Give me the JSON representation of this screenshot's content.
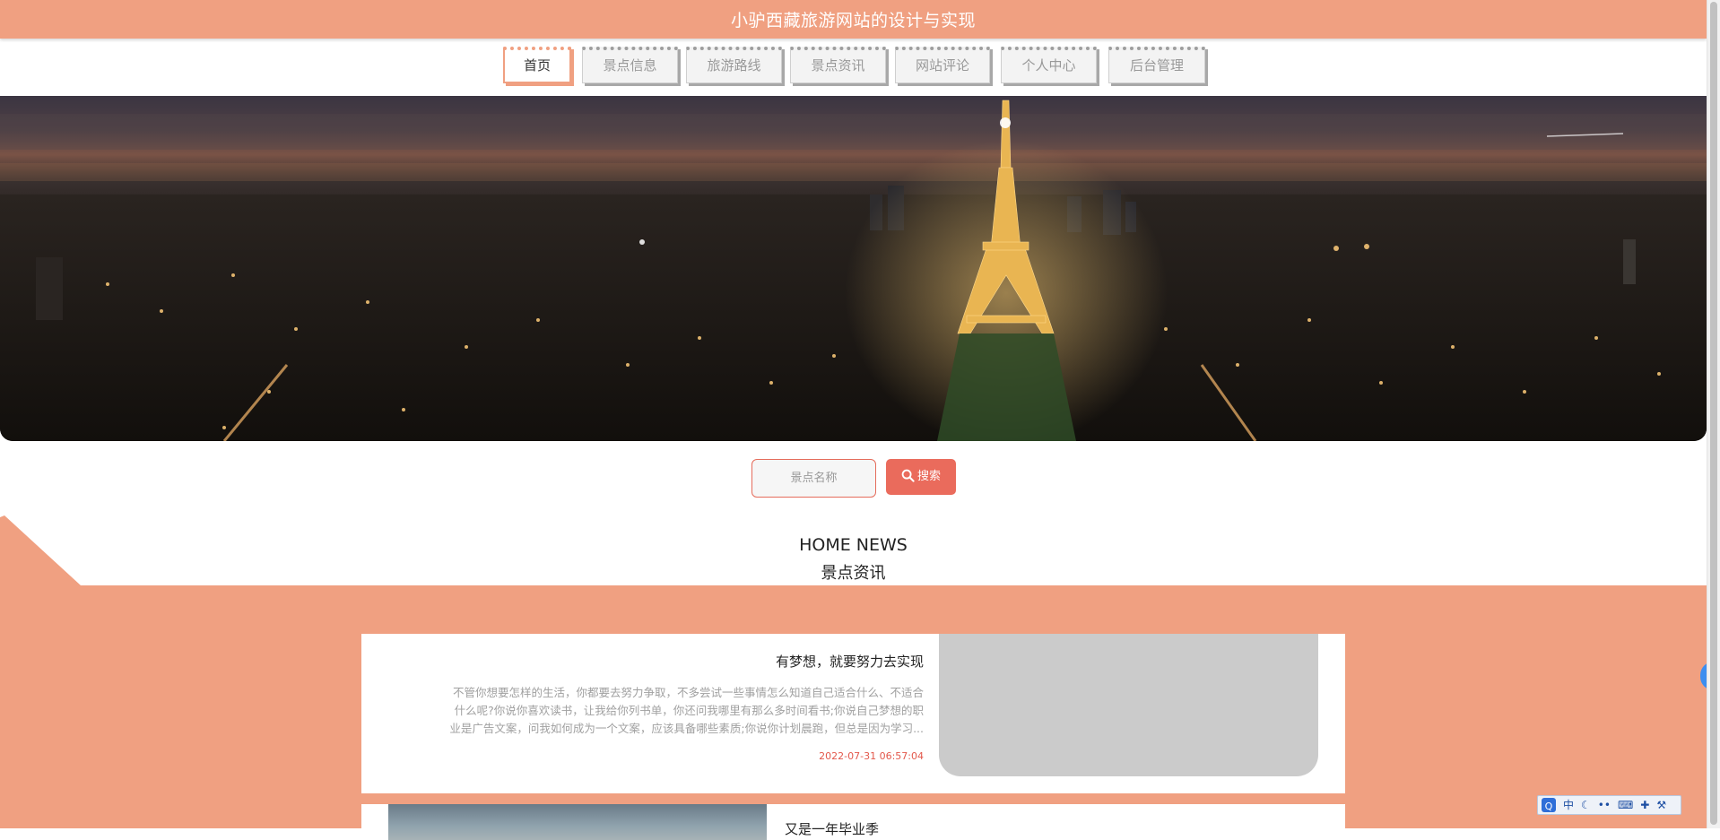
{
  "site": {
    "title": "小驴西藏旅游网站的设计与实现"
  },
  "nav": {
    "items": [
      {
        "label": "首页"
      },
      {
        "label": "景点信息"
      },
      {
        "label": "旅游路线"
      },
      {
        "label": "景点资讯"
      },
      {
        "label": "网站评论"
      },
      {
        "label": "个人中心"
      },
      {
        "label": "后台管理"
      }
    ],
    "active": "首页"
  },
  "search": {
    "placeholder": "景点名称",
    "button_label": "搜索"
  },
  "news_section": {
    "title_en": "HOME NEWS",
    "title_cn": "景点资讯"
  },
  "news": [
    {
      "title": "有梦想，就要努力去实现",
      "summary_lines": [
        "不管你想要怎样的生活，你都要去努力争取，不多尝试一些事情怎么知道自己适合什么、不适合",
        "什么呢?你说你喜欢读书，让我给你列书单，你还问我哪里有那么多时间看书;你说自己梦想的职",
        "业是广告文案，问我如何成为一个文案，应该具备哪些素质;你说你计划晨跑，但总是因为学习..."
      ],
      "date": "2022-07-31 06:57:04"
    },
    {
      "title": "又是一年毕业季"
    }
  ],
  "ime_toolbar": {
    "logo": "Q",
    "mode": "中"
  },
  "colors": {
    "brand": "#f0a081",
    "accent": "#ea6b5c",
    "date": "#e3584b"
  },
  "icons": {
    "search": "magnifier-icon",
    "side": "chevron-left-icon"
  }
}
